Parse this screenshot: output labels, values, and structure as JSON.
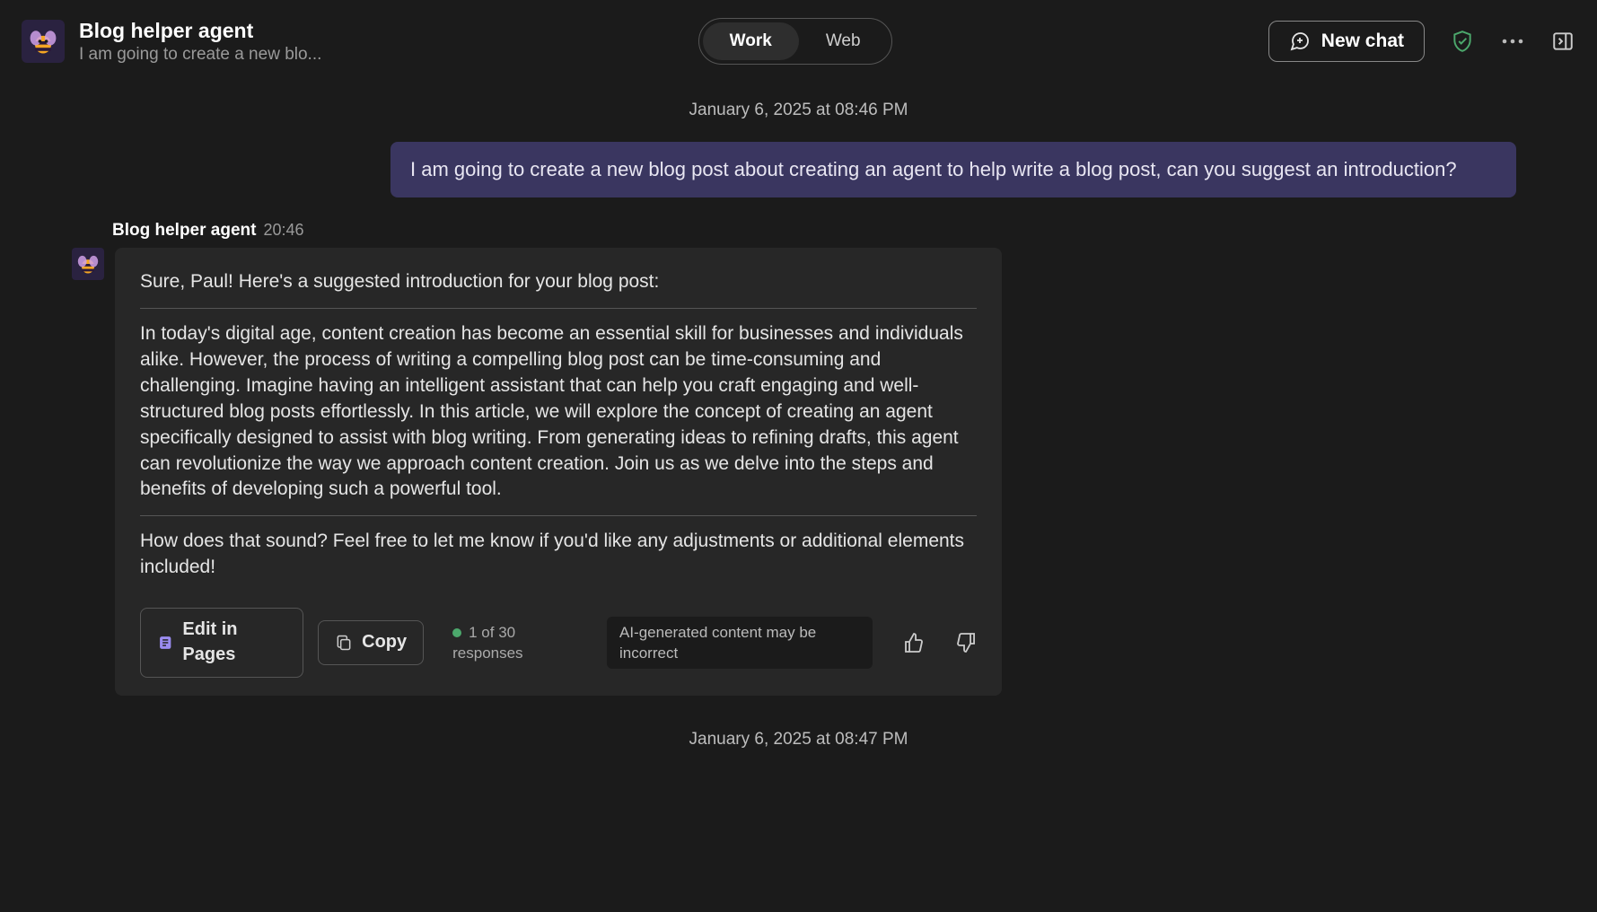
{
  "header": {
    "agent_name": "Blog helper agent",
    "subtitle": "I am going to create a new blo...",
    "tabs": {
      "work": "Work",
      "web": "Web"
    },
    "new_chat": "New chat"
  },
  "timestamps": {
    "t1": "January 6, 2025 at 08:46 PM",
    "t2": "January 6, 2025 at 08:47 PM"
  },
  "user_message": "I am going to create a new blog post about creating an agent to help write a blog post, can you suggest an introduction?",
  "agent": {
    "name": "Blog helper agent",
    "time": "20:46",
    "intro": "Sure, Paul! Here's a suggested introduction for your blog post:",
    "body": "In today's digital age, content creation has become an essential skill for businesses and individuals alike. However, the process of writing a compelling blog post can be time-consuming and challenging. Imagine having an intelligent assistant that can help you craft engaging and well-structured blog posts effortlessly. In this article, we will explore the concept of creating an agent specifically designed to assist with blog writing. From generating ideas to refining drafts, this agent can revolutionize the way we approach content creation. Join us as we delve into the steps and benefits of developing such a powerful tool.",
    "followup": "How does that sound? Feel free to let me know if you'd like any adjustments or additional elements included!"
  },
  "actions": {
    "edit": "Edit in Pages",
    "copy": "Copy",
    "responses": "1 of 30 responses",
    "disclaimer": "AI-generated content may be incorrect"
  }
}
